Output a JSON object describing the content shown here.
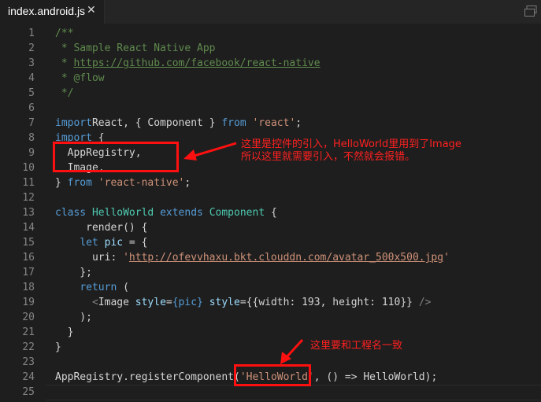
{
  "tab": {
    "title": "index.android.js",
    "close": "✕"
  },
  "editor": {
    "lines": [
      {
        "n": "1",
        "t": [
          [
            "c",
            "/**"
          ]
        ]
      },
      {
        "n": "2",
        "t": [
          [
            "c",
            " * Sample React Native App"
          ]
        ]
      },
      {
        "n": "3",
        "t": [
          [
            "c",
            " * "
          ],
          [
            "u",
            "https://github.com/facebook/react-native"
          ]
        ]
      },
      {
        "n": "4",
        "t": [
          [
            "c",
            " * @flow"
          ]
        ]
      },
      {
        "n": "5",
        "t": [
          [
            "c",
            " */"
          ]
        ]
      },
      {
        "n": "6",
        "t": []
      },
      {
        "n": "7",
        "t": [
          [
            "k",
            "import"
          ],
          [
            "",
            "React, { Component } "
          ],
          [
            "k",
            "from"
          ],
          [
            "",
            " "
          ],
          [
            "s",
            "'react'"
          ],
          [
            "",
            ";"
          ]
        ]
      },
      {
        "n": "8",
        "t": [
          [
            "k",
            "import"
          ],
          [
            "",
            " {"
          ]
        ]
      },
      {
        "n": "9",
        "t": [
          [
            "",
            "  AppRegistry,"
          ]
        ]
      },
      {
        "n": "10",
        "t": [
          [
            "",
            "  Image,"
          ]
        ]
      },
      {
        "n": "11",
        "t": [
          [
            "",
            "} "
          ],
          [
            "k",
            "from"
          ],
          [
            "",
            " "
          ],
          [
            "s",
            "'react-native'"
          ],
          [
            "",
            ";"
          ]
        ]
      },
      {
        "n": "12",
        "t": []
      },
      {
        "n": "13",
        "t": [
          [
            "k",
            "class"
          ],
          [
            "",
            " "
          ],
          [
            "t",
            "HelloWorld"
          ],
          [
            "",
            " "
          ],
          [
            "k",
            "extends"
          ],
          [
            "",
            " "
          ],
          [
            "t",
            "Component"
          ],
          [
            "",
            " {"
          ]
        ]
      },
      {
        "n": "14",
        "t": [
          [
            "",
            "     render() {"
          ]
        ]
      },
      {
        "n": "15",
        "t": [
          [
            "",
            "    "
          ],
          [
            "k",
            "let"
          ],
          [
            "",
            " "
          ],
          [
            "a",
            "pic"
          ],
          [
            "",
            " = {"
          ]
        ]
      },
      {
        "n": "16",
        "t": [
          [
            "",
            "      uri: "
          ],
          [
            "s",
            "'"
          ],
          [
            "su",
            "http://ofevvhaxu.bkt.clouddn.com/avatar_500x500.jpg"
          ],
          [
            "s",
            "'"
          ]
        ]
      },
      {
        "n": "17",
        "t": [
          [
            "",
            "    };"
          ]
        ]
      },
      {
        "n": "18",
        "t": [
          [
            "",
            "    "
          ],
          [
            "k",
            "return"
          ],
          [
            "",
            " ("
          ]
        ]
      },
      {
        "n": "19",
        "t": [
          [
            "",
            "      "
          ],
          [
            "g",
            "<"
          ],
          [
            "",
            "Image "
          ],
          [
            "a",
            "style"
          ],
          [
            "",
            "="
          ],
          [
            "k",
            "{pic}"
          ],
          [
            "",
            " "
          ],
          [
            "a",
            "style"
          ],
          [
            "",
            "={{width: 193, height: 110}} "
          ],
          [
            "g",
            "/>"
          ]
        ]
      },
      {
        "n": "20",
        "t": [
          [
            "",
            "    );"
          ]
        ]
      },
      {
        "n": "21",
        "t": [
          [
            "",
            "  }"
          ]
        ]
      },
      {
        "n": "22",
        "t": [
          [
            "",
            "}"
          ]
        ]
      },
      {
        "n": "23",
        "t": []
      },
      {
        "n": "24",
        "t": [
          [
            "",
            "AppRegistry.registerComponent("
          ],
          [
            "s",
            "'HelloWorld'"
          ],
          [
            "",
            ", () => HelloWorld);"
          ]
        ]
      },
      {
        "n": "25",
        "t": []
      }
    ]
  },
  "annotations": {
    "note1_line1": "这里是控件的引入，HelloWorld里用到了Image",
    "note1_line2": "所以这里就需要引入，不然就会报错。",
    "note2": "这里要和工程名一致"
  },
  "colors": {
    "highlight": "#ff1010",
    "background": "#1e1e1e"
  }
}
